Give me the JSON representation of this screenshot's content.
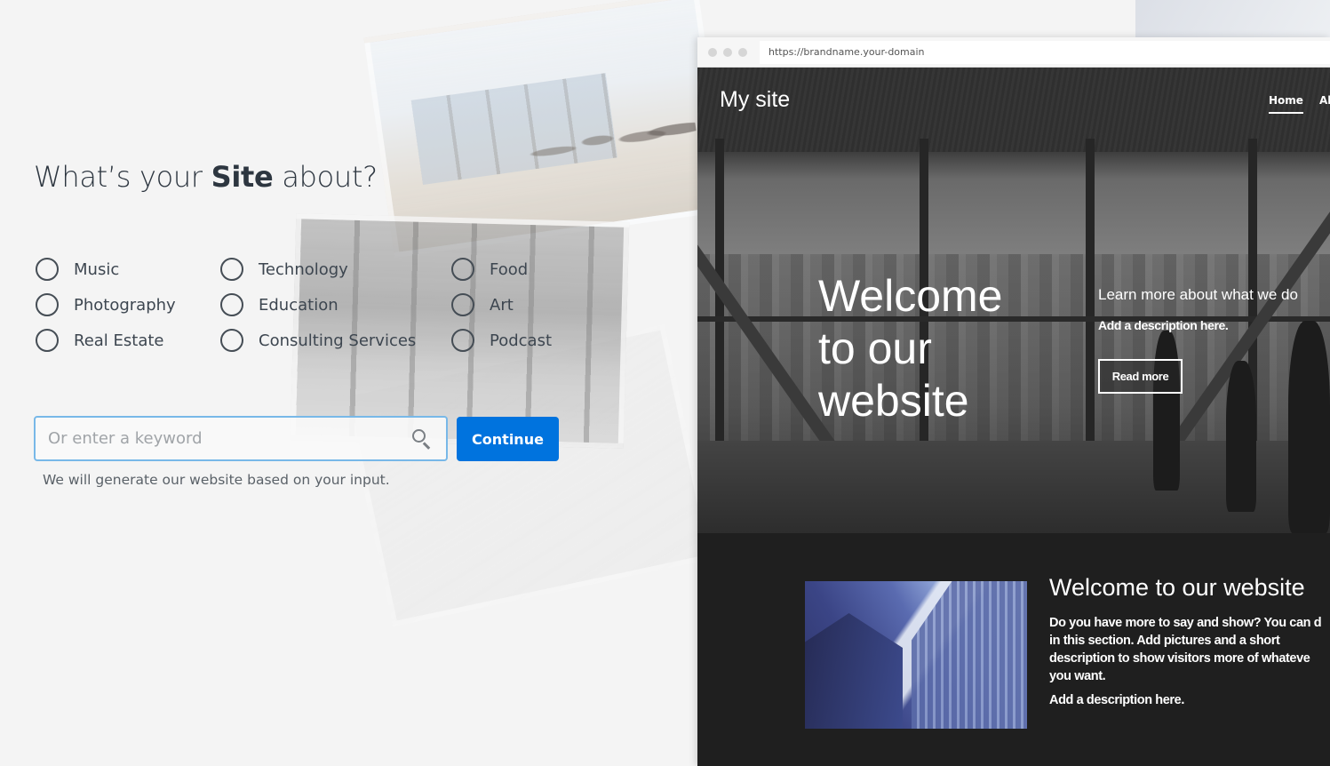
{
  "left_panel": {
    "title_prefix": "What’s your ",
    "title_bold": "Site",
    "title_suffix": " about?",
    "categories": [
      {
        "label": "Music",
        "selected": false
      },
      {
        "label": "Photography",
        "selected": false
      },
      {
        "label": "Real Estate",
        "selected": false
      },
      {
        "label": "Technology",
        "selected": false
      },
      {
        "label": "Education",
        "selected": false
      },
      {
        "label": "Consulting Services",
        "selected": false
      },
      {
        "label": "Food",
        "selected": false
      },
      {
        "label": "Art",
        "selected": false
      },
      {
        "label": "Podcast",
        "selected": false
      }
    ],
    "search": {
      "placeholder": "Or enter a keyword",
      "value": "",
      "icon": "search-icon"
    },
    "continue_label": "Continue",
    "hint": "We will generate our website based on your input.",
    "accent_color": "#0073de"
  },
  "preview": {
    "url": "https://brandname.your-domain",
    "site_name": "My site",
    "nav": [
      "Home",
      "Abo"
    ],
    "nav_active": "Home",
    "hero": {
      "title_lines": [
        "Welcome",
        "to our",
        "website"
      ],
      "subtitle": "Learn more about what we do",
      "description": "Add a description here.",
      "button": "Read more"
    },
    "section": {
      "title": "Welcome to our website",
      "body_lines": [
        "Do you have more to say and show? You can d",
        "in this section. Add pictures and a short",
        "description to show visitors more of whateve",
        "you want."
      ],
      "description": "Add a description here."
    }
  }
}
